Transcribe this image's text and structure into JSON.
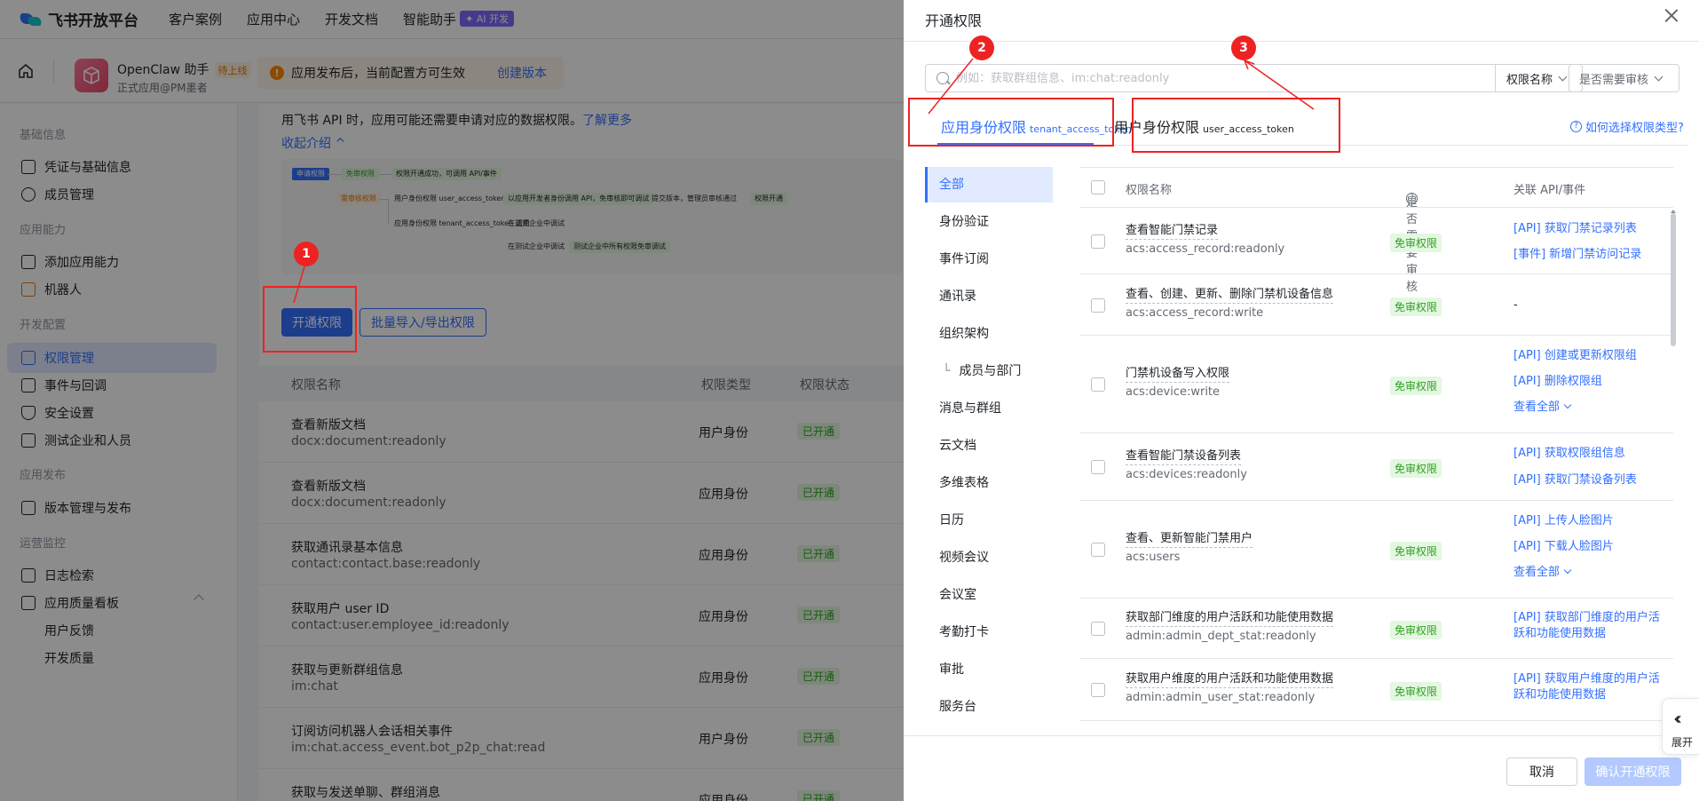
{
  "topnav": {
    "brand": "飞书开放平台",
    "links": [
      "客户案例",
      "应用中心",
      "开发文档",
      "智能助手"
    ],
    "ai_badge": "✦ AI 开发"
  },
  "appbar": {
    "app_name": "OpenClaw 助手",
    "app_tag": "待上线",
    "app_sub": "正式应用@PM墨者",
    "notice": "应用发布后，当前配置方可生效",
    "create_version": "创建版本"
  },
  "sidebar": {
    "groups": [
      "基础信息",
      "应用能力",
      "开发配置",
      "应用发布",
      "运营监控"
    ],
    "items": [
      "凭证与基础信息",
      "成员管理",
      "添加应用能力",
      "机器人",
      "权限管理",
      "事件与回调",
      "安全设置",
      "测试企业和人员",
      "版本管理与发布",
      "日志检索",
      "应用质量看板",
      "用户反馈",
      "开发质量"
    ]
  },
  "main": {
    "intro_text": "用飞书 API 时，应用可能还需要申请对应的数据权限。",
    "learn_more": "了解更多",
    "collapse": "收起介绍 ^",
    "flow": [
      "申请权限",
      "免审权限",
      "权限开通成功，可调用 API/事件",
      "需审核权限",
      "用户身份权限 user_access_token 调用",
      "以应用开发者身份调用 API，免审核即可调试",
      "提交版本，管理员审核通过",
      "权限开通",
      "应用身份权限 tenant_access_token 调用",
      "在正式企业中调试",
      "在测试企业中调试",
      "测试企业中所有权限免审调试"
    ],
    "btn_open": "开通权限",
    "btn_batch": "批量导入/导出权限",
    "table_headers": [
      "权限名称",
      "权限类型",
      "权限状态"
    ],
    "rows": [
      {
        "name": "查看新版文档",
        "key": "docx:document:readonly",
        "type": "用户身份",
        "status": "已开通"
      },
      {
        "name": "查看新版文档",
        "key": "docx:document:readonly",
        "type": "应用身份",
        "status": "已开通"
      },
      {
        "name": "获取通讯录基本信息",
        "key": "contact:contact.base:readonly",
        "type": "应用身份",
        "status": "已开通"
      },
      {
        "name": "获取用户 user ID",
        "key": "contact:user.employee_id:readonly",
        "type": "应用身份",
        "status": "已开通"
      },
      {
        "name": "获取与更新群组信息",
        "key": "im:chat",
        "type": "应用身份",
        "status": "已开通"
      },
      {
        "name": "订阅访问机器人会话相关事件",
        "key": "im:chat.access_event.bot_p2p_chat:read",
        "type": "用户身份",
        "status": "已开通"
      },
      {
        "name": "获取与发送单聊、群组消息",
        "key": "",
        "type": "应用身份",
        "status": "已开通"
      }
    ]
  },
  "drawer": {
    "title": "开通权限",
    "search_placeholder": "例如：获取群组信息、im:chat:readonly",
    "select_name": "权限名称",
    "select_review": "是否需要审核",
    "tab_app": "应用身份权限",
    "tab_app_token": "tenant_access_token",
    "tab_user": "用户身份权限",
    "tab_user_token": "user_access_token",
    "help_link": "如何选择权限类型?",
    "categories": [
      "全部",
      "身份验证",
      "事件订阅",
      "通讯录",
      "组织架构",
      "成员与部门",
      "消息与群组",
      "云文档",
      "多维表格",
      "日历",
      "视频会议",
      "会议室",
      "考勤打卡",
      "审批",
      "服务台"
    ],
    "headers": [
      "权限名称",
      "是否需要审核",
      "关联 API/事件"
    ],
    "rows": [
      {
        "name": "查看智能门禁记录",
        "key": "acs:access_record:readonly",
        "tag": "免审权限",
        "apis": [
          "[API] 获取门禁记录列表",
          "[事件] 新增门禁访问记录"
        ]
      },
      {
        "name": "查看、创建、更新、删除门禁机设备信息",
        "key": "acs:access_record:write",
        "tag": "免审权限",
        "apis": [
          "-"
        ]
      },
      {
        "name": "门禁机设备写入权限",
        "key": "acs:device:write",
        "tag": "免审权限",
        "apis": [
          "[API] 创建或更新权限组",
          "[API] 删除权限组",
          "查看全部"
        ]
      },
      {
        "name": "查看智能门禁设备列表",
        "key": "acs:devices:readonly",
        "tag": "免审权限",
        "apis": [
          "[API] 获取权限组信息",
          "[API] 获取门禁设备列表"
        ]
      },
      {
        "name": "查看、更新智能门禁用户",
        "key": "acs:users",
        "tag": "免审权限",
        "apis": [
          "[API] 上传人脸图片",
          "[API] 下载人脸图片",
          "查看全部"
        ]
      },
      {
        "name": "获取部门维度的用户活跃和功能使用数据",
        "key": "admin:admin_dept_stat:readonly",
        "tag": "免审权限",
        "apis": [
          "[API] 获取部门维度的用户活跃和功能使用数据"
        ]
      },
      {
        "name": "获取用户维度的用户活跃和功能使用数据",
        "key": "admin:admin_user_stat:readonly",
        "tag": "免审权限",
        "apis": [
          "[API] 获取用户维度的用户活跃和功能使用数据"
        ]
      }
    ],
    "cancel": "取消",
    "confirm": "确认开通权限",
    "expand_label": "展开"
  },
  "annotations": [
    "1",
    "2",
    "3"
  ]
}
